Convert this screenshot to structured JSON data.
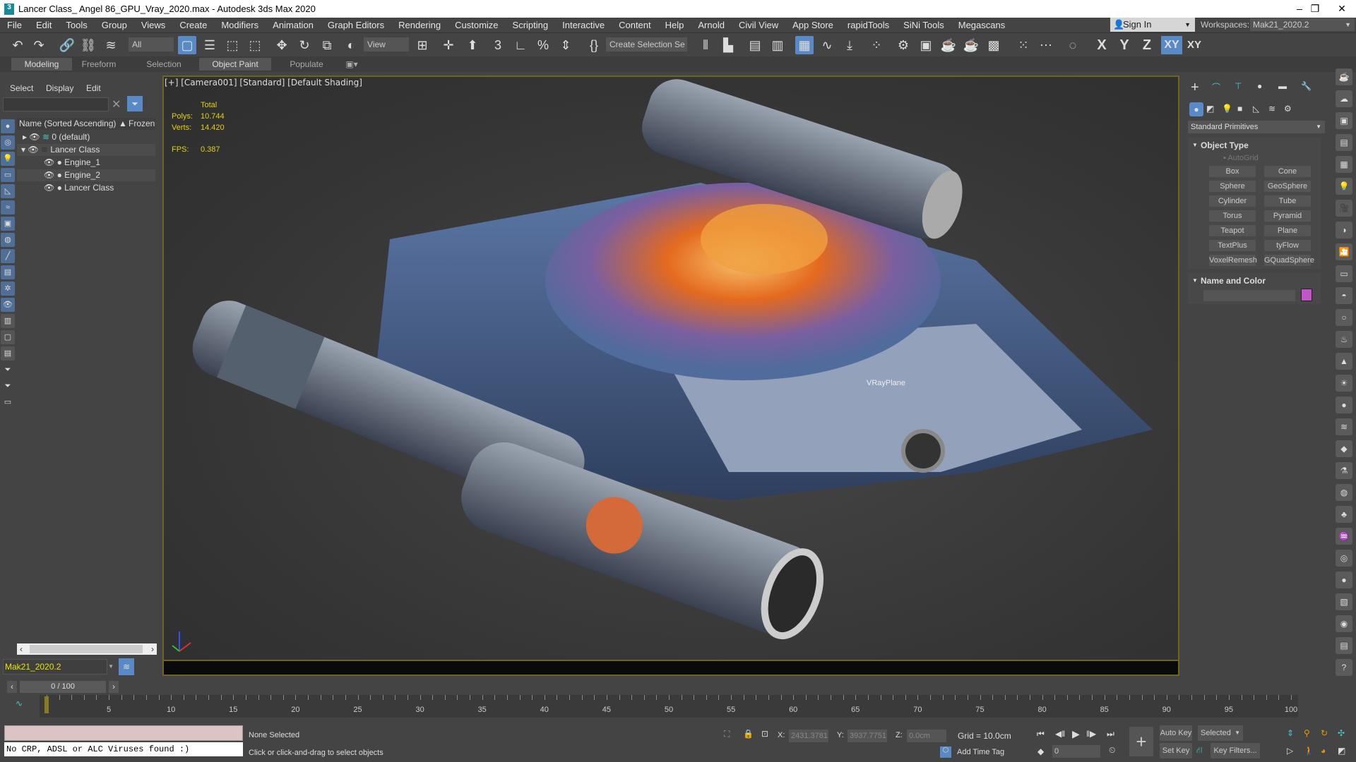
{
  "window": {
    "title": "Lancer Class_ Angel 86_GPU_Vray_2020.max - Autodesk 3ds Max 2020",
    "minimize": "–",
    "restore": "❐",
    "close": "✕"
  },
  "menu": [
    "File",
    "Edit",
    "Tools",
    "Group",
    "Views",
    "Create",
    "Modifiers",
    "Animation",
    "Graph Editors",
    "Rendering",
    "Customize",
    "Scripting",
    "Interactive",
    "Content",
    "Help",
    "Arnold",
    "Civil View",
    "App Store",
    "rapidTools",
    "SiNi Tools",
    "Megascans"
  ],
  "account": {
    "sign_in": "Sign In",
    "workspaces_label": "Workspaces:",
    "workspace": "Mak21_2020.2"
  },
  "toolbar": {
    "filter": "All",
    "ref_coord": "View",
    "selection_set": "Create Selection Se",
    "axes": [
      "X",
      "Y",
      "Z",
      "XY",
      "XY"
    ]
  },
  "ribbon": {
    "tabs": [
      "Modeling",
      "Freeform",
      "Selection",
      "Object Paint",
      "Populate"
    ]
  },
  "explorer": {
    "tabs": [
      "Select",
      "Display",
      "Edit"
    ],
    "search_placeholder": "",
    "col_name": "Name (Sorted Ascending)",
    "col_frozen": "Frozen",
    "rows": [
      {
        "name": "0 (default)",
        "level": 0
      },
      {
        "name": "Lancer Class",
        "level": 0
      },
      {
        "name": "Engine_1",
        "level": 1
      },
      {
        "name": "Engine_2",
        "level": 1
      },
      {
        "name": "Lancer Class",
        "level": 1
      }
    ],
    "layer": "Mak21_2020.2"
  },
  "viewport": {
    "label": "[+] [Camera001] [Standard] [Default Shading]",
    "stats": {
      "total": "Total",
      "polys_label": "Polys:",
      "polys": "10.744",
      "verts_label": "Verts:",
      "verts": "14.420",
      "fps_label": "FPS:",
      "fps": "0.387"
    },
    "object_label": "VRayPlane"
  },
  "command_panel": {
    "category": "Standard Primitives",
    "object_type": "Object Type",
    "autogrid": "AutoGrid",
    "primitives": [
      "Box",
      "Cone",
      "Sphere",
      "GeoSphere",
      "Cylinder",
      "Tube",
      "Torus",
      "Pyramid",
      "Teapot",
      "Plane",
      "TextPlus",
      "tyFlow",
      "VoxelRemesh",
      "GQuadSphere"
    ],
    "name_and_color": "Name and Color",
    "color": "#c455c8"
  },
  "timeline": {
    "frame": "0 / 100",
    "start": 0,
    "end": 100,
    "current": 0,
    "labels": [
      0,
      5,
      10,
      15,
      20,
      25,
      30,
      35,
      40,
      45,
      50,
      55,
      60,
      65,
      70,
      75,
      80,
      85,
      90,
      95,
      100
    ]
  },
  "status": {
    "maxscript": "No CRP, ADSL or ALC Viruses found :)",
    "selection": "None Selected",
    "prompt": "Click or click-and-drag to select objects",
    "x_label": "X:",
    "x": "2431.3781",
    "y_label": "Y:",
    "y": "3937.7751",
    "z_label": "Z:",
    "z": "0.0cm",
    "grid": "Grid = 10.0cm",
    "add_time_tag": "Add Time Tag",
    "frame_field": "0",
    "auto_key": "Auto Key",
    "set_key": "Set Key",
    "key_mode": "Selected",
    "key_filters": "Key Filters..."
  }
}
